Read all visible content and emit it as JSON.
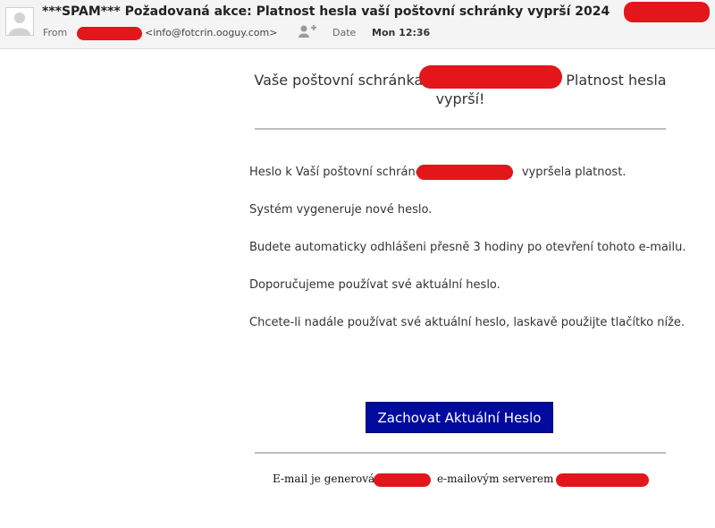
{
  "header": {
    "subject": "***SPAM*** Požadovaná akce: Platnost hesla vaší poštovní schránky vyprší 2024",
    "from_label": "From",
    "from_email": "<info@fotcrin.ooguy.com>",
    "date_label": "Date",
    "date_value": "Mon 12:36"
  },
  "body": {
    "title_part1": "Vaše poštovní schránka",
    "title_part2": "Platnost hesla",
    "title_line2": "vyprší!",
    "para1_a": "Heslo k Vaší poštovní schránce",
    "para1_b": "vypršela platnost.",
    "para2": "Systém vygeneruje nové heslo.",
    "para3": "Budete automaticky odhlášeni přesně 3 hodiny po otevření tohoto e-mailu.",
    "para4": "Doporučujeme používat své aktuální heslo.",
    "para5": "Chcete-li nadále používat své aktuální heslo, laskavě použijte tlačítko níže.",
    "button_label": "Zachovat Aktuální Heslo",
    "footer_a": "E-mail je generován",
    "footer_b": "e-mailovým serverem pro"
  },
  "colors": {
    "button_bg": "#000b9d",
    "redaction": "#e3161b"
  },
  "icons": {
    "avatar": "user-avatar-icon",
    "add_contact": "add-contact-icon"
  }
}
